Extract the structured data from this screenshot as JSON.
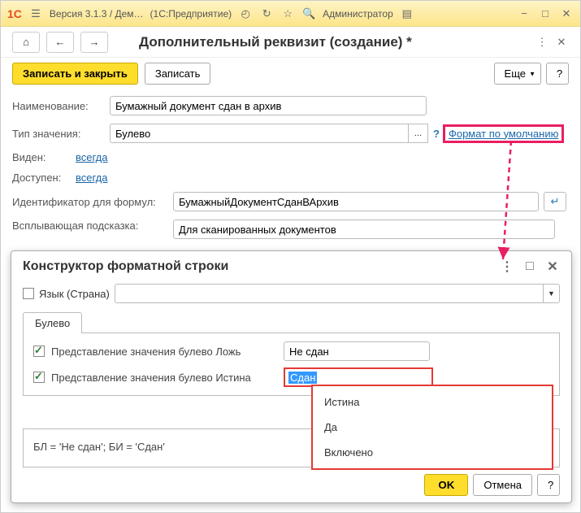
{
  "titlebar": {
    "version": "Версия 3.1.3 / Дем…",
    "app": "(1С:Предприятие)",
    "user": "Администратор"
  },
  "page": {
    "title": "Дополнительный реквизит (создание) *"
  },
  "buttons": {
    "save_close": "Записать и закрыть",
    "save": "Записать",
    "more": "Еще",
    "help": "?"
  },
  "form": {
    "name_lbl": "Наименование:",
    "name_val": "Бумажный документ сдан в архив",
    "type_lbl": "Тип значения:",
    "type_val": "Булево",
    "type_pick": "…",
    "format_link": "Формат по умолчанию",
    "visible_lbl": "Виден:",
    "always": "всегда",
    "avail_lbl": "Доступен:",
    "id_lbl": "Идентификатор для формул:",
    "id_val": "БумажныйДокументСданВАрхив",
    "tooltip_lbl": "Всплывающая подсказка:",
    "tooltip_val": "Для сканированных документов"
  },
  "modal": {
    "title": "Конструктор форматной строки",
    "lang_lbl": "Язык (Страна)",
    "tab": "Булево",
    "false_lbl": "Представление значения булево Ложь",
    "false_val": "Не сдан",
    "true_lbl": "Представление значения булево Истина",
    "true_val": "Сдан",
    "options": [
      "Истина",
      "Да",
      "Включено"
    ],
    "preview": "БЛ = 'Не сдан'; БИ = 'Сдан'",
    "ok": "OK",
    "cancel": "Отмена",
    "help": "?"
  }
}
